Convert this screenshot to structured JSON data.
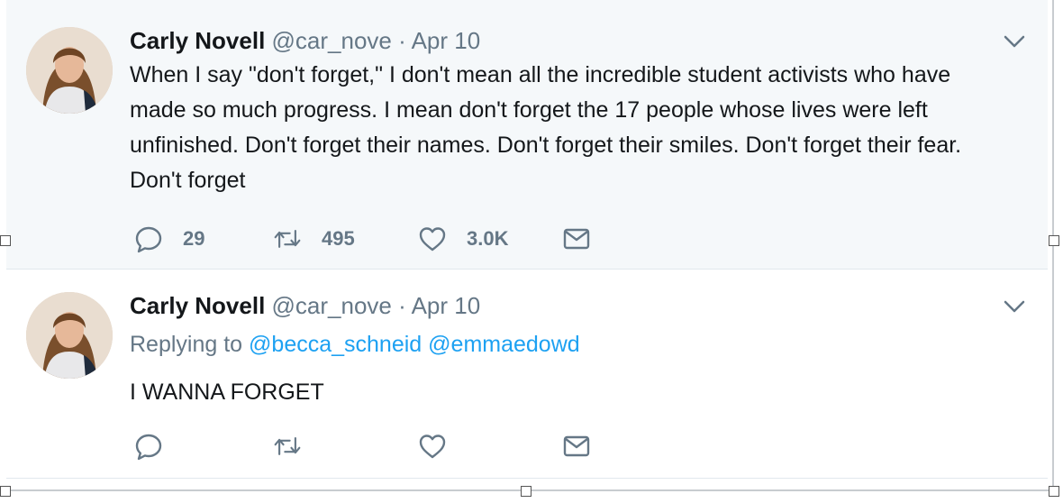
{
  "tweets": [
    {
      "author_name": "Carly Novell",
      "handle": "@car_nove",
      "separator": "·",
      "date": "Apr 10",
      "text": "When I say \"don't forget,\" I don't mean all the incredible student activists who have made so much progress. I mean don't forget the 17 people whose lives were left unfinished. Don't forget their names. Don't forget their smiles. Don't forget their fear. Don't forget",
      "reply_count": "29",
      "retweet_count": "495",
      "like_count": "3.0K"
    },
    {
      "author_name": "Carly Novell",
      "handle": "@car_nove",
      "separator": "·",
      "date": "Apr 10",
      "replying_prefix": "Replying to",
      "replying_mentions": [
        "@becca_schneid",
        "@emmaedowd"
      ],
      "text": "I WANNA FORGET",
      "reply_count": "",
      "retweet_count": "",
      "like_count": ""
    }
  ],
  "icons": {
    "reply": "reply-icon",
    "retweet": "retweet-icon",
    "like": "heart-icon",
    "dm": "envelope-icon",
    "menu": "chevron-down-icon"
  },
  "colors": {
    "highlight_bg": "#f5f8fa",
    "link": "#1da1f2",
    "muted": "#657786",
    "text": "#14171a"
  }
}
